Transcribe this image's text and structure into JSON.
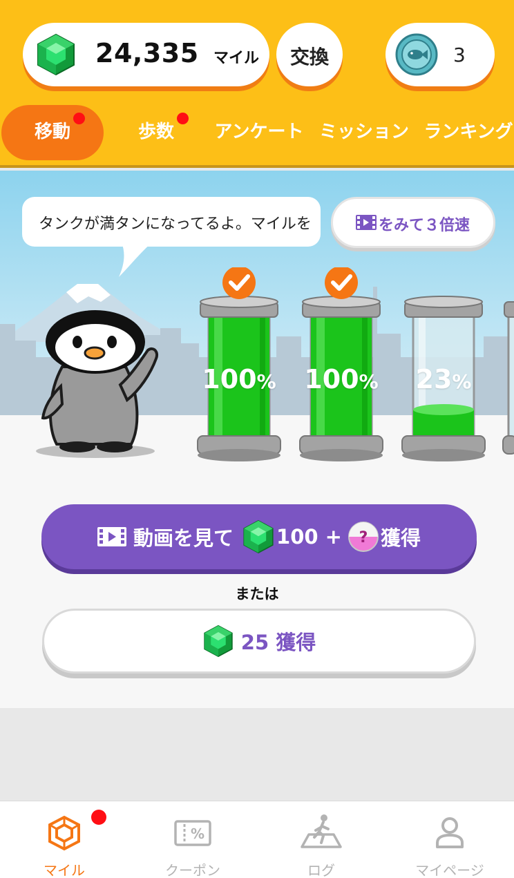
{
  "header": {
    "miles_value": "24,335",
    "miles_unit": "マイル",
    "exchange_label": "交換",
    "coin_count": "3"
  },
  "tabs": [
    {
      "label": "移動",
      "active": true,
      "badge": true
    },
    {
      "label": "歩数",
      "active": false,
      "badge": true
    },
    {
      "label": "アンケート",
      "active": false,
      "badge": false
    },
    {
      "label": "ミッション",
      "active": false,
      "badge": false
    },
    {
      "label": "ランキング",
      "active": false,
      "badge": false
    }
  ],
  "scene": {
    "bubble_text": "タンクが満タンになってるよ。マイルを",
    "video_speed_label": "をみて３倍速",
    "tanks": [
      {
        "percent": "100",
        "fill": 1.0,
        "checked": true
      },
      {
        "percent": "100",
        "fill": 1.0,
        "checked": true
      },
      {
        "percent": "23",
        "fill": 0.23,
        "checked": false
      }
    ],
    "percent_sign": "%"
  },
  "cta": {
    "video_prefix": "動画を見て",
    "video_amount": "100 +",
    "video_suffix": "獲得",
    "or_text": "または",
    "plain_label": "25 獲得"
  },
  "bottom_nav": [
    {
      "label": "マイル",
      "icon": "gem-outline-icon",
      "active": true
    },
    {
      "label": "クーポン",
      "icon": "coupon-icon",
      "active": false
    },
    {
      "label": "ログ",
      "icon": "walking-log-icon",
      "active": false
    },
    {
      "label": "マイページ",
      "icon": "person-icon",
      "active": false
    }
  ],
  "colors": {
    "header_bg": "#fdbf17",
    "accent_orange": "#f57614",
    "accent_purple": "#7b55c2",
    "tank_green": "#1bc41b",
    "badge_red": "#ff0e14"
  }
}
